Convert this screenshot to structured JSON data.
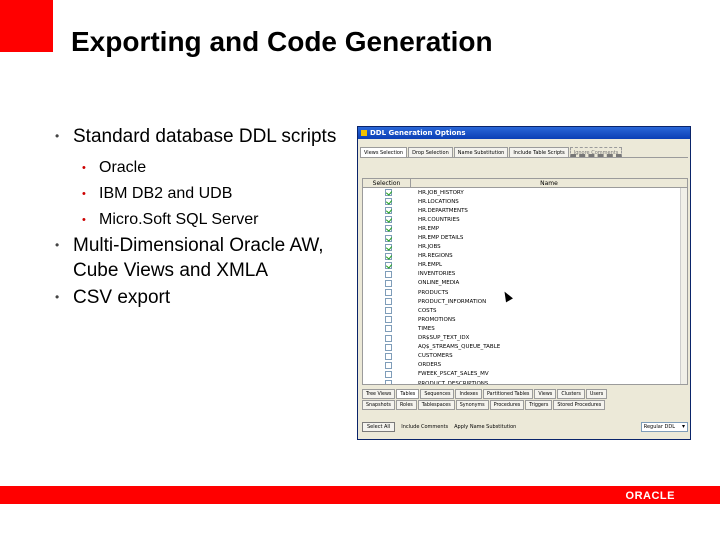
{
  "slide": {
    "title": "Exporting and Code Generation",
    "bullets": [
      {
        "text": "Standard database DDL scripts",
        "sub": [
          "Oracle",
          "IBM DB2 and UDB",
          "Micro.Soft SQL Server"
        ]
      },
      {
        "text": "Multi-Dimensional Oracle AW, Cube Views and XMLA"
      },
      {
        "text": "CSV export"
      }
    ],
    "bullet_glyph": "•",
    "logo_text": "ORACLE"
  },
  "screenshot": {
    "window_title": "DDL Generation Options",
    "top_tabs": [
      "Views Selection",
      "Drop Selection",
      "Name Substitution",
      "Include Table Scripts",
      "Ignore Comments"
    ],
    "grid_headers": [
      "Selection",
      "Name"
    ],
    "rows": [
      {
        "name": "HR.JOB_HISTORY",
        "checked": true
      },
      {
        "name": "HR.LOCATIONS",
        "checked": true
      },
      {
        "name": "HR.DEPARTMENTS",
        "checked": true
      },
      {
        "name": "HR.COUNTRIES",
        "checked": true
      },
      {
        "name": "HR.EMP",
        "checked": true
      },
      {
        "name": "HR.EMP DETAILS",
        "checked": true
      },
      {
        "name": "HR.JOBS",
        "checked": true
      },
      {
        "name": "HR.REGIONS",
        "checked": true
      },
      {
        "name": "HR.EMPL",
        "checked": true
      },
      {
        "name": "INVENTORIES",
        "checked": false
      },
      {
        "name": "ONLINE_MEDIA",
        "checked": false
      },
      {
        "name": "PRODUCTS",
        "checked": false
      },
      {
        "name": "PRODUCT_INFORMATION",
        "checked": false
      },
      {
        "name": "COSTS",
        "checked": false
      },
      {
        "name": "PROMOTIONS",
        "checked": false
      },
      {
        "name": "TIMES",
        "checked": false
      },
      {
        "name": "DR$SUP_TEXT_IDX",
        "checked": false
      },
      {
        "name": "AQ$_STREAMS_QUEUE_TABLE",
        "checked": false
      },
      {
        "name": "CUSTOMERS",
        "checked": false
      },
      {
        "name": "ORDERS",
        "checked": false
      },
      {
        "name": "FWEEK_PSCAT_SALES_MV",
        "checked": false
      },
      {
        "name": "PRODUCT_DESCRIPTIONS",
        "checked": false
      }
    ],
    "bottom_tabs_row1": [
      "Tree Views",
      "Tables",
      "Sequences",
      "Indexes",
      "Partitioned Tables",
      "Views",
      "Clusters",
      "Users"
    ],
    "bottom_tabs_row2": [
      "Snapshots",
      "Roles",
      "Tablespaces",
      "Synonyms",
      "Procedures",
      "Triggers",
      "Stored Procedures"
    ],
    "buttons": [
      "Select All",
      "Include Comments",
      "Apply Name Substitution"
    ],
    "select_value": "Regular DDL"
  }
}
